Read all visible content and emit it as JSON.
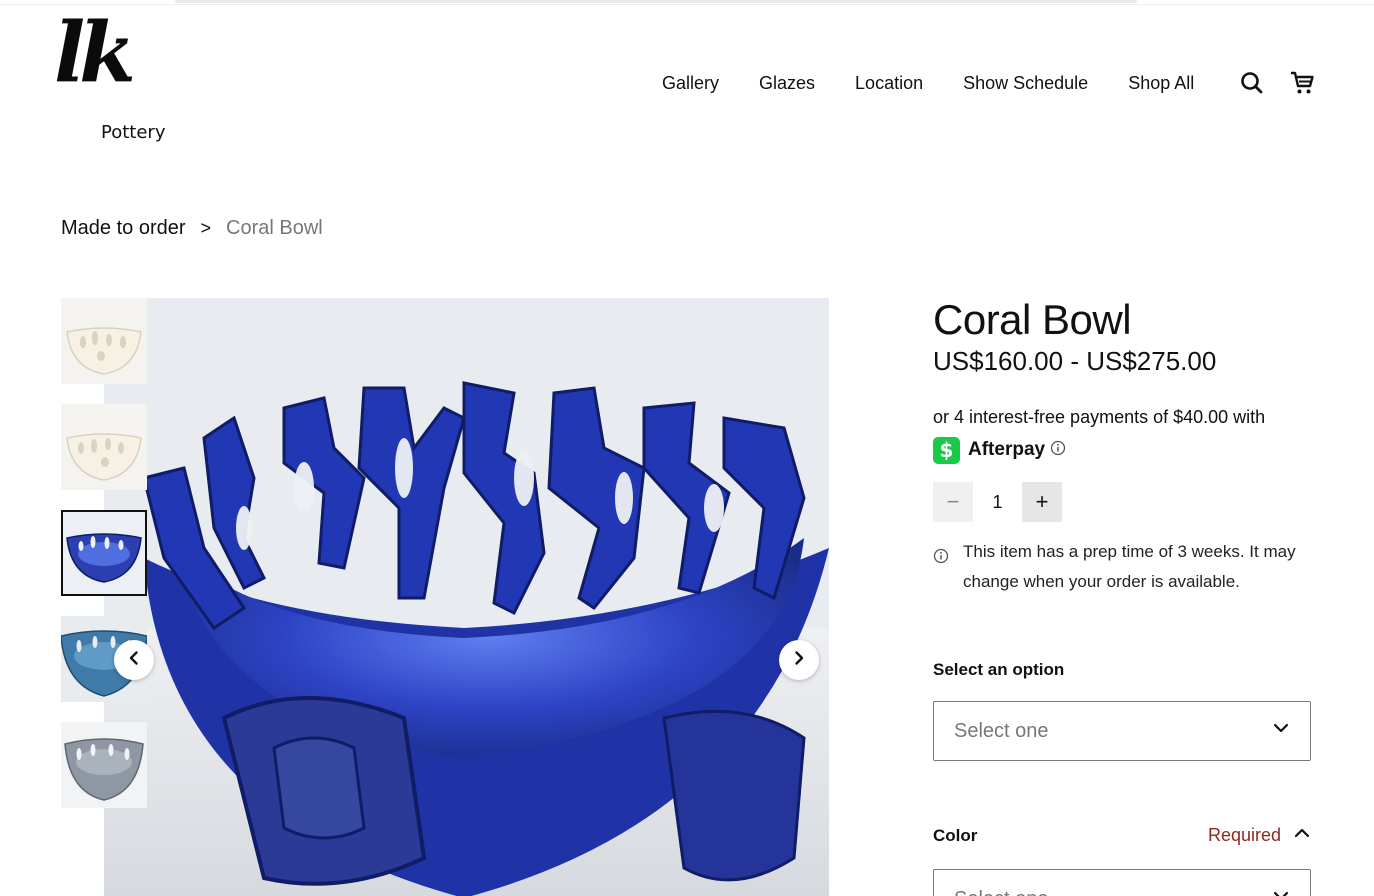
{
  "brand": {
    "logo_mark": "lk",
    "logo_sub": "Pottery"
  },
  "nav": {
    "items": [
      "Gallery",
      "Glazes",
      "Location",
      "Show Schedule",
      "Shop All"
    ],
    "search_icon": "search-icon",
    "cart_icon": "cart-icon"
  },
  "breadcrumb": {
    "parent": "Made to order",
    "separator": ">",
    "current": "Coral Bowl"
  },
  "gallery": {
    "thumbnails": [
      {
        "name": "white-coral-bowl-1",
        "tone": "#f3f0e8"
      },
      {
        "name": "white-coral-bowl-2",
        "tone": "#f3f0e8"
      },
      {
        "name": "blue-coral-bowl",
        "tone": "#2b3fb0",
        "active": true
      },
      {
        "name": "teal-coral-bowl",
        "tone": "#3f7aa8"
      },
      {
        "name": "gray-coral-bowl",
        "tone": "#8e97a3"
      }
    ],
    "prev_icon": "chevron-left-icon",
    "next_icon": "chevron-right-icon"
  },
  "product": {
    "title": "Coral Bowl",
    "price": "US$160.00 - US$275.00",
    "afterpay_text": "or 4 interest-free payments of $40.00 with",
    "afterpay_brand": "Afterpay",
    "afterpay_symbol": "$",
    "quantity": "1",
    "minus": "−",
    "plus": "+",
    "prep_note": "This item has a prep time of 3 weeks. It may change when your order is available."
  },
  "options": {
    "select_label": "Select an option",
    "select_placeholder": "Select one",
    "color_label": "Color",
    "color_required": "Required",
    "color_placeholder": "Select one"
  },
  "colors": {
    "accent_green": "#19c948",
    "required_red": "#8a2a20",
    "glaze_blue": "#2b3fb0"
  }
}
